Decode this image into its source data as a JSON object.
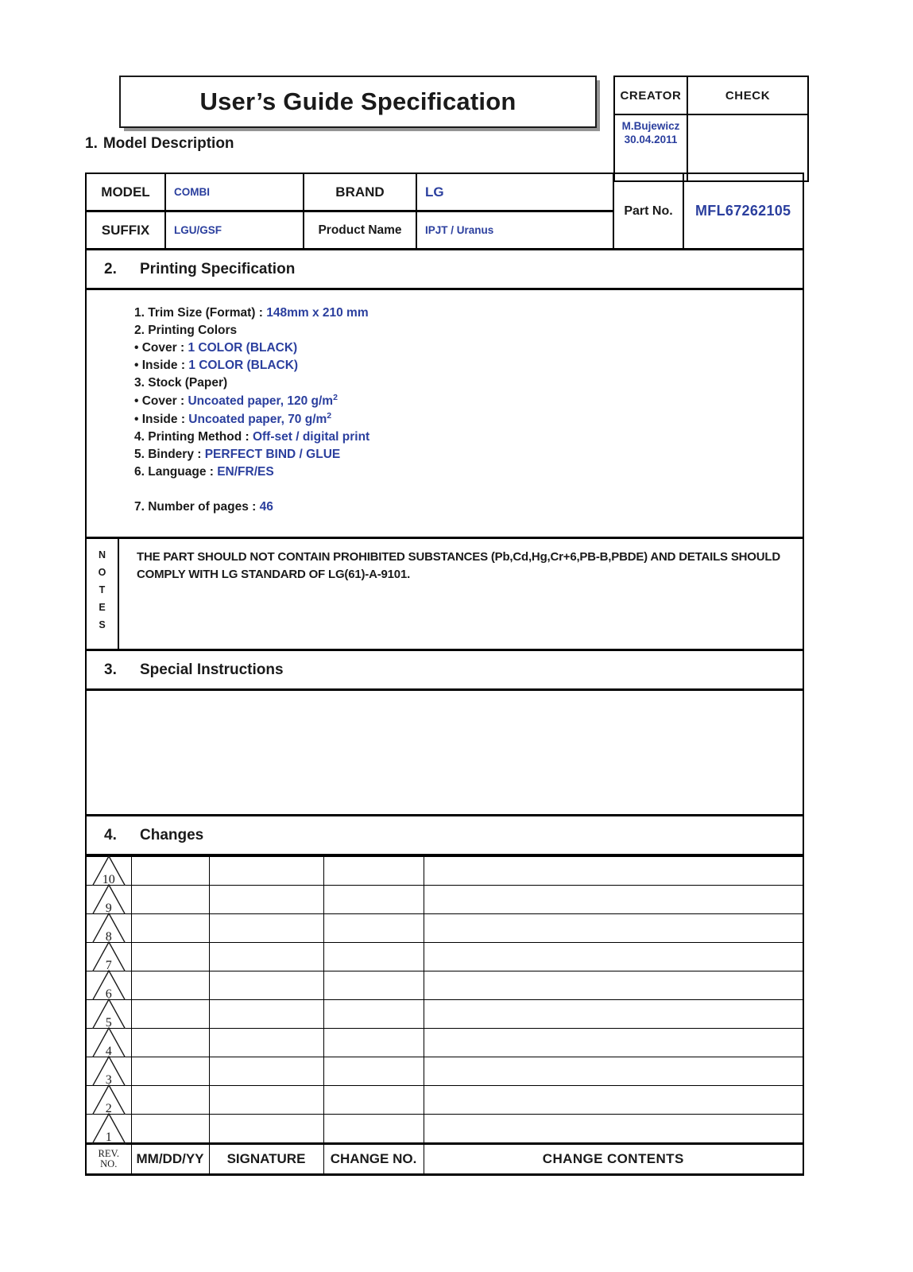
{
  "document": {
    "title": "User’s Guide Specification"
  },
  "header_table": {
    "creator_label": "CREATOR",
    "check_label": "CHECK",
    "creator_name": "M.Bujewicz",
    "creator_date": "30.04.2011",
    "check_value": ""
  },
  "section1": {
    "number": "1.",
    "title": "Model Description"
  },
  "model": {
    "model_label": "MODEL",
    "model_value": "COMBI",
    "brand_label": "BRAND",
    "brand_value": "LG",
    "suffix_label": "SUFFIX",
    "suffix_value": "LGU/GSF",
    "product_name_label": "Product Name",
    "product_name_value": "IPJT / Uranus",
    "part_no_label": "Part No.",
    "part_no_value": "MFL67262105"
  },
  "section2": {
    "number": "2.",
    "title": "Printing Specification",
    "lines": [
      {
        "label": "1. Trim Size (Format) : ",
        "value": "148mm x 210 mm"
      },
      {
        "label": "2. Printing Colors",
        "value": ""
      },
      {
        "label": "• Cover : ",
        "value": "1 COLOR (BLACK)"
      },
      {
        "label": "• Inside : ",
        "value": "1 COLOR (BLACK)"
      },
      {
        "label": "3. Stock (Paper)",
        "value": ""
      },
      {
        "label": "• Cover : ",
        "value": "Uncoated paper,  120 g/m",
        "sup": "2"
      },
      {
        "label": "• Inside : ",
        "value": "Uncoated paper,  70 g/m",
        "sup": "2"
      },
      {
        "label": "4. Printing Method : ",
        "value": "Off-set / digital print"
      },
      {
        "label": "5. Bindery  : ",
        "value": "PERFECT BIND / GLUE"
      },
      {
        "label": "6. Language : ",
        "value": "EN/FR/ES"
      }
    ],
    "pages_label": "7. Number of pages :  ",
    "pages_value": "46"
  },
  "notes": {
    "label_letters": [
      "N",
      "O",
      "T",
      "E",
      "S"
    ],
    "text": "THE PART SHOULD NOT CONTAIN PROHIBITED SUBSTANCES (Pb,Cd,Hg,Cr+6,PB-B,PBDE) AND DETAILS SHOULD COMPLY WITH LG STANDARD OF LG(61)-A-9101."
  },
  "section3": {
    "number": "3.",
    "title": "Special Instructions",
    "body": ""
  },
  "section4": {
    "number": "4.",
    "title": "Changes",
    "columns": [
      "REV. NO.",
      "MM/DD/YY",
      "SIGNATURE",
      "CHANGE NO.",
      "CHANGE CONTENTS"
    ],
    "footer": {
      "rev_line1": "REV.",
      "rev_line2": "NO.",
      "date": "MM/DD/YY",
      "signature": "SIGNATURE",
      "change_no": "CHANGE NO.",
      "change_contents": "CHANGE CONTENTS"
    },
    "rows": [
      {
        "rev": "10",
        "date": "",
        "signature": "",
        "change_no": "",
        "change_contents": ""
      },
      {
        "rev": "9",
        "date": "",
        "signature": "",
        "change_no": "",
        "change_contents": ""
      },
      {
        "rev": "8",
        "date": "",
        "signature": "",
        "change_no": "",
        "change_contents": ""
      },
      {
        "rev": "7",
        "date": "",
        "signature": "",
        "change_no": "",
        "change_contents": ""
      },
      {
        "rev": "6",
        "date": "",
        "signature": "",
        "change_no": "",
        "change_contents": ""
      },
      {
        "rev": "5",
        "date": "",
        "signature": "",
        "change_no": "",
        "change_contents": ""
      },
      {
        "rev": "4",
        "date": "",
        "signature": "",
        "change_no": "",
        "change_contents": ""
      },
      {
        "rev": "3",
        "date": "",
        "signature": "",
        "change_no": "",
        "change_contents": ""
      },
      {
        "rev": "2",
        "date": "",
        "signature": "",
        "change_no": "",
        "change_contents": ""
      },
      {
        "rev": "1",
        "date": "",
        "signature": "",
        "change_no": "",
        "change_contents": ""
      }
    ]
  },
  "colors": {
    "value_blue": "#2b3f9e",
    "ink_black": "#1a1a1a"
  }
}
